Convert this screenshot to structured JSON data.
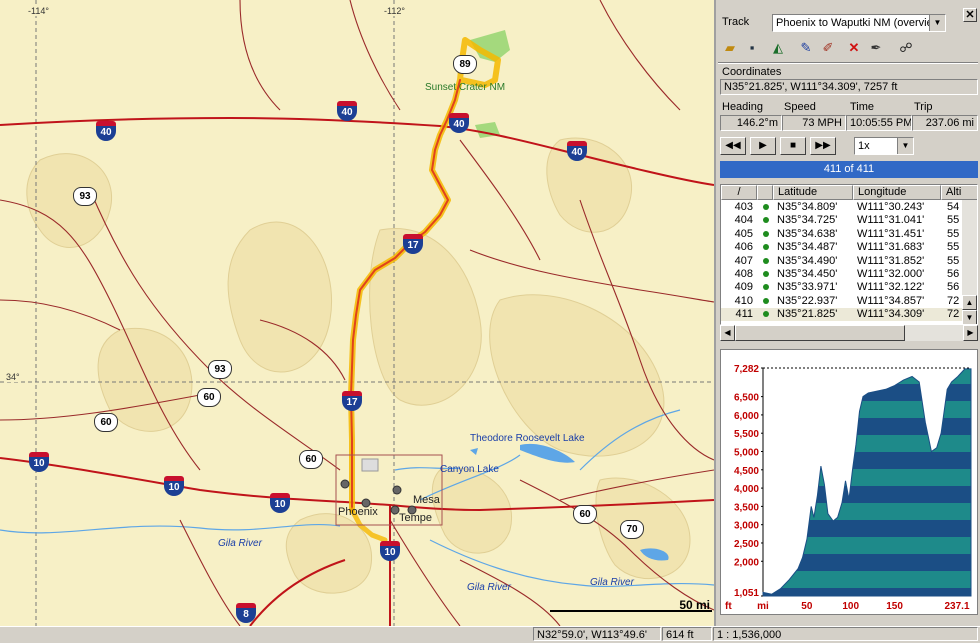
{
  "map": {
    "grid_labels": {
      "lon1": "-114°",
      "lon2": "-112°",
      "lat1": "34°"
    },
    "cities": {
      "phoenix": "Phoenix",
      "mesa": "Mesa",
      "tempe": "Tempe"
    },
    "places": {
      "sunset_crater": "Sunset Crater NM",
      "roosevelt_lake": "Theodore Roosevelt Lake",
      "canyon_lake": "Canyon Lake",
      "gila_river_1": "Gila River",
      "gila_river_2": "Gila River",
      "gila_river_3": "Gila River"
    },
    "interstate_shields": [
      "40",
      "40",
      "40",
      "40",
      "17",
      "17",
      "10",
      "10",
      "10",
      "10",
      "8"
    ],
    "us_shields": [
      "93",
      "89",
      "93",
      "60",
      "60",
      "60",
      "60",
      "70"
    ],
    "scale_label": "50 mi",
    "colors": {
      "track": "#e0421b",
      "track_glow": "#f5b800",
      "road": "#b01010",
      "water": "#5ea6e6",
      "park": "#8ed36a"
    }
  },
  "status": {
    "coords": "N32°59.0', W113°49.6'",
    "elevation": "614 ft",
    "scale": "1 : 1,536,000"
  },
  "panel": {
    "track_label": "Track",
    "track_value": "Phoenix to Waputki NM (overview",
    "toolbar_icons": [
      "open-folder-icon",
      "save-icon",
      "profile-chart-icon",
      "track-tool-a-icon",
      "track-tool-b-icon",
      "delete-icon",
      "edit-pen-icon",
      "binoculars-icon"
    ],
    "coordinates_label": "Coordinates",
    "coordinates_value": "N35°21.825',  W111°34.309',  7257 ft",
    "heading_label": "Heading",
    "speed_label": "Speed",
    "time_label": "Time",
    "trip_label": "Trip",
    "heading_value": "146.2°m",
    "speed_value": "73 MPH",
    "time_value": "10:05:55 PM",
    "trip_value": "237.06 mi",
    "speed_multiplier": "1x",
    "progress_text": "411 of 411",
    "progress_fraction": 1.0
  },
  "table": {
    "headers": [
      "/",
      "",
      "Latitude",
      "Longitude",
      "Alti"
    ],
    "rows": [
      {
        "num": "403",
        "lat": "N35°34.809'",
        "lon": "W111°30.243'",
        "alt": "54"
      },
      {
        "num": "404",
        "lat": "N35°34.725'",
        "lon": "W111°31.041'",
        "alt": "55"
      },
      {
        "num": "405",
        "lat": "N35°34.638'",
        "lon": "W111°31.451'",
        "alt": "55"
      },
      {
        "num": "406",
        "lat": "N35°34.487'",
        "lon": "W111°31.683'",
        "alt": "55"
      },
      {
        "num": "407",
        "lat": "N35°34.490'",
        "lon": "W111°31.852'",
        "alt": "55"
      },
      {
        "num": "408",
        "lat": "N35°34.450'",
        "lon": "W111°32.000'",
        "alt": "56"
      },
      {
        "num": "409",
        "lat": "N35°33.971'",
        "lon": "W111°32.122'",
        "alt": "56"
      },
      {
        "num": "410",
        "lat": "N35°22.937'",
        "lon": "W111°34.857'",
        "alt": "72"
      },
      {
        "num": "411",
        "lat": "N35°21.825'",
        "lon": "W111°34.309'",
        "alt": "72"
      }
    ]
  },
  "chart_data": {
    "type": "area",
    "y_ticks": [
      "7,282",
      "6,500",
      "6,000",
      "5,500",
      "5,000",
      "4,500",
      "4,000",
      "3,500",
      "3,000",
      "2,500",
      "2,000",
      "1,051"
    ],
    "x_ticks": [
      "mi",
      "50",
      "100",
      "150",
      "237.1"
    ],
    "y_unit": "ft",
    "ylim": [
      1051,
      7282
    ],
    "xlim": [
      0,
      237.1
    ],
    "profile": [
      [
        0,
        1150
      ],
      [
        10,
        1100
      ],
      [
        20,
        1250
      ],
      [
        30,
        1500
      ],
      [
        40,
        1800
      ],
      [
        45,
        2100
      ],
      [
        50,
        2600
      ],
      [
        55,
        3500
      ],
      [
        58,
        3200
      ],
      [
        62,
        3800
      ],
      [
        66,
        4600
      ],
      [
        70,
        4100
      ],
      [
        74,
        3300
      ],
      [
        80,
        3100
      ],
      [
        85,
        3200
      ],
      [
        90,
        3600
      ],
      [
        94,
        4200
      ],
      [
        98,
        3700
      ],
      [
        102,
        4500
      ],
      [
        106,
        5200
      ],
      [
        110,
        6100
      ],
      [
        114,
        6500
      ],
      [
        120,
        6600
      ],
      [
        130,
        6650
      ],
      [
        140,
        6700
      ],
      [
        150,
        6800
      ],
      [
        160,
        6950
      ],
      [
        170,
        7050
      ],
      [
        178,
        6900
      ],
      [
        185,
        5800
      ],
      [
        192,
        5000
      ],
      [
        198,
        5100
      ],
      [
        203,
        5500
      ],
      [
        210,
        6700
      ],
      [
        215,
        6900
      ],
      [
        222,
        7050
      ],
      [
        230,
        7257
      ],
      [
        237.1,
        7257
      ]
    ],
    "colors": {
      "fill_dark": "#1b4e85",
      "fill_light": "#1e8a8a",
      "axis_label": "#c00000"
    }
  }
}
